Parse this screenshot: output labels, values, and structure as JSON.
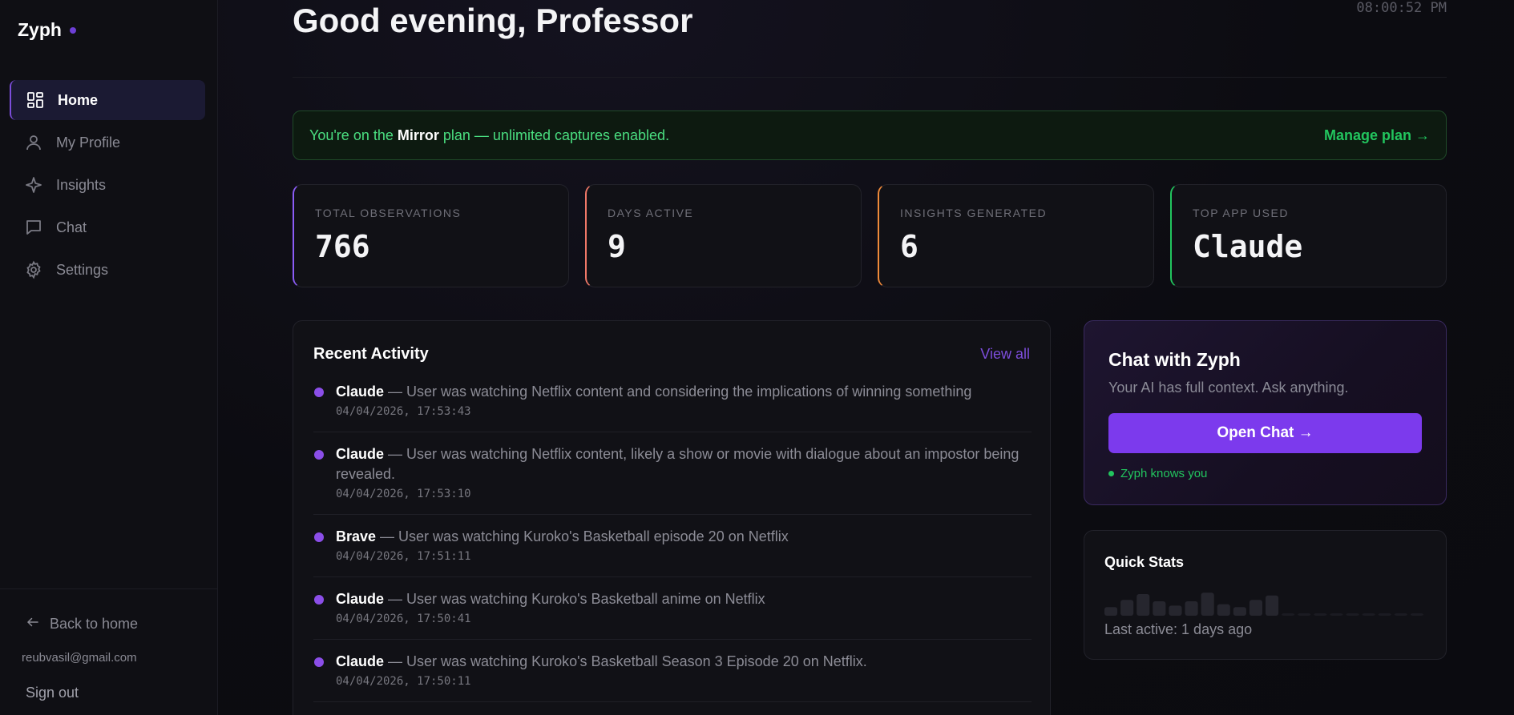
{
  "sidebar": {
    "brand": "Zyph",
    "nav": [
      {
        "label": "Home",
        "icon": "grid-icon",
        "active": true
      },
      {
        "label": "My Profile",
        "icon": "user-icon",
        "active": false
      },
      {
        "label": "Insights",
        "icon": "sparkle-icon",
        "active": false
      },
      {
        "label": "Chat",
        "icon": "chat-bubble-icon",
        "active": false
      },
      {
        "label": "Settings",
        "icon": "gear-icon",
        "active": false
      }
    ],
    "back_home": "Back to home",
    "email": "reubvasil@gmail.com",
    "sign_out": "Sign out"
  },
  "header": {
    "greeting": "Good evening, Professor",
    "clock": "08:00:52 PM"
  },
  "plan": {
    "prefix": "You're on the ",
    "plan_name": "Mirror",
    "suffix": " plan — unlimited captures enabled.",
    "manage": "Manage plan →"
  },
  "stats": [
    {
      "label": "TOTAL OBSERVATIONS",
      "value": "766",
      "accent": "#8b5cf6"
    },
    {
      "label": "DAYS ACTIVE",
      "value": "9",
      "accent": "#f07868"
    },
    {
      "label": "INSIGHTS GENERATED",
      "value": "6",
      "accent": "#f08a3a"
    },
    {
      "label": "TOP APP USED",
      "value": "Claude",
      "accent": "#22c55e"
    }
  ],
  "activity": {
    "title": "Recent Activity",
    "view_all": "View all",
    "items": [
      {
        "app": "Claude",
        "text": " — User was watching Netflix content and considering the implications of winning something",
        "time": "04/04/2026, 17:53:43"
      },
      {
        "app": "Claude",
        "text": " — User was watching Netflix content, likely a show or movie with dialogue about an impostor being revealed.",
        "time": "04/04/2026, 17:53:10"
      },
      {
        "app": "Brave",
        "text": " — User was watching Kuroko's Basketball episode 20 on Netflix",
        "time": "04/04/2026, 17:51:11"
      },
      {
        "app": "Claude",
        "text": " — User was watching Kuroko's Basketball anime on Netflix",
        "time": "04/04/2026, 17:50:41"
      },
      {
        "app": "Claude",
        "text": " — User was watching Kuroko's Basketball Season 3 Episode 20 on Netflix.",
        "time": "04/04/2026, 17:50:11"
      }
    ]
  },
  "chat_card": {
    "title": "Chat with Zyph",
    "subtitle": "Your AI has full context. Ask anything.",
    "button": "Open Chat →",
    "status": "Zyph knows you"
  },
  "quick_stats": {
    "title": "Quick Stats",
    "activity_levels": [
      0.3,
      0.55,
      0.75,
      0.5,
      0.35,
      0.5,
      0.8,
      0.4,
      0.3,
      0.55,
      0.7,
      0.05,
      0.05,
      0.05,
      0.05,
      0.05,
      0.05,
      0.05,
      0.05,
      0.05
    ],
    "last_active": "Last active: 1 days ago"
  },
  "colors": {
    "accent_purple": "#7c3aed",
    "success_green": "#22c55e"
  }
}
